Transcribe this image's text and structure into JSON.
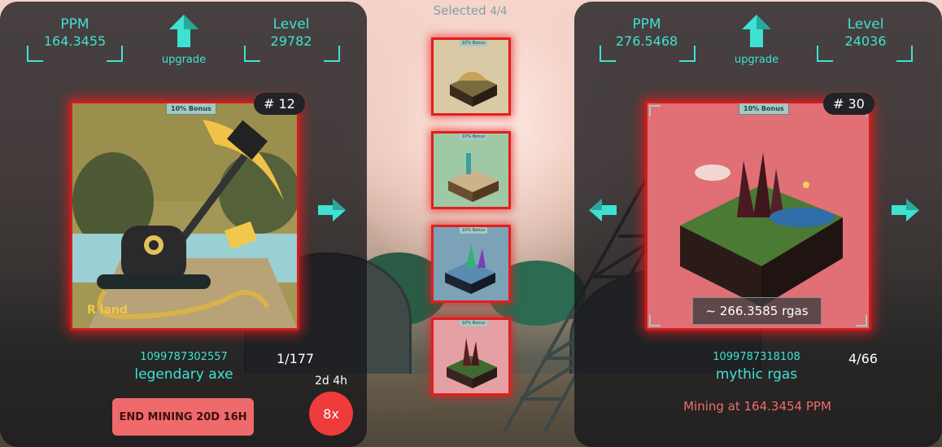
{
  "selected": {
    "label": "Selected",
    "count": "4/4"
  },
  "left": {
    "ppm_label": "PPM",
    "ppm_value": "164.3455",
    "upgrade_label": "upgrade",
    "level_label": "Level",
    "level_value": "29782",
    "card": {
      "bonus": "10% Bonus",
      "number": "# 12",
      "id": "1099787302557",
      "name": "legendary axe",
      "count": "1/177",
      "logo": "R land"
    },
    "end_mining_label": "END MINING 20D 16H",
    "timer": "2d 4h",
    "multiplier": "8x"
  },
  "right": {
    "ppm_label": "PPM",
    "ppm_value": "276.5468",
    "upgrade_label": "upgrade",
    "level_label": "Level",
    "level_value": "24036",
    "card": {
      "bonus": "10% Bonus",
      "number": "# 30",
      "id": "1099787318108",
      "name": "mythic rgas",
      "count": "4/66",
      "rgas_value": "~ 266.3585 rgas"
    },
    "mining_status": "Mining at 164.3454 PPM"
  },
  "thumbnails": [
    {
      "bonus": "10% Bonus",
      "color": "#d9c9a4"
    },
    {
      "bonus": "10% Bonus",
      "color": "#9fc9a5"
    },
    {
      "bonus": "10% Bonus",
      "color": "#7ca2b8"
    },
    {
      "bonus": "10% Bonus",
      "color": "#e4a0a2"
    }
  ],
  "colors": {
    "accent": "#3ee2d3",
    "danger": "#ef3b3b",
    "button": "#ef6a6a"
  },
  "icons": [
    "upgrade-arrow-icon",
    "next-arrow-icon",
    "prev-arrow-icon"
  ]
}
